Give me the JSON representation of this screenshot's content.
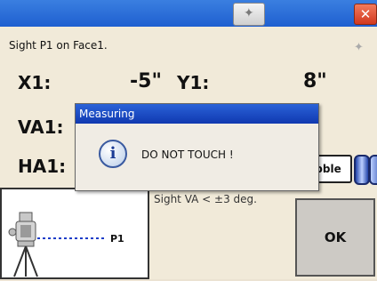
{
  "instruction": "Sight P1 on Face1.",
  "readings": {
    "x1": {
      "label": "X1:",
      "value": "-5\""
    },
    "y1": {
      "label": "Y1:",
      "value": "8\""
    },
    "va1": {
      "label": "VA1:"
    },
    "ha1": {
      "label": "HA1:"
    }
  },
  "bubble_button_label": "bble",
  "hint": "Sight VA < ±3 deg.",
  "target_label": "P1",
  "ok_label": "OK",
  "dialog": {
    "title": "Measuring",
    "message": "DO NOT TOUCH !"
  },
  "colors": {
    "titlebar": "#1f5fd0",
    "background": "#f1ead9",
    "sight_line": "#1a3cc8"
  },
  "icons": [
    "close-icon",
    "spark-icon",
    "info-icon",
    "bubble-level-icon"
  ]
}
